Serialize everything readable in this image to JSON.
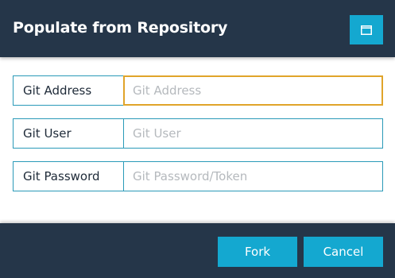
{
  "dialog": {
    "title": "Populate from Repository",
    "maximize_icon": "window-maximize-icon"
  },
  "form": {
    "fields": [
      {
        "label": "Git Address",
        "placeholder": "Git Address",
        "value": ""
      },
      {
        "label": "Git User",
        "placeholder": "Git User",
        "value": ""
      },
      {
        "label": "Git Password",
        "placeholder": "Git Password/Token",
        "value": ""
      }
    ]
  },
  "footer": {
    "fork_label": "Fork",
    "cancel_label": "Cancel"
  },
  "colors": {
    "header_bg": "#253649",
    "accent": "#14a8d0",
    "border": "#2a9ab8",
    "focus_border": "#e0a42a"
  }
}
